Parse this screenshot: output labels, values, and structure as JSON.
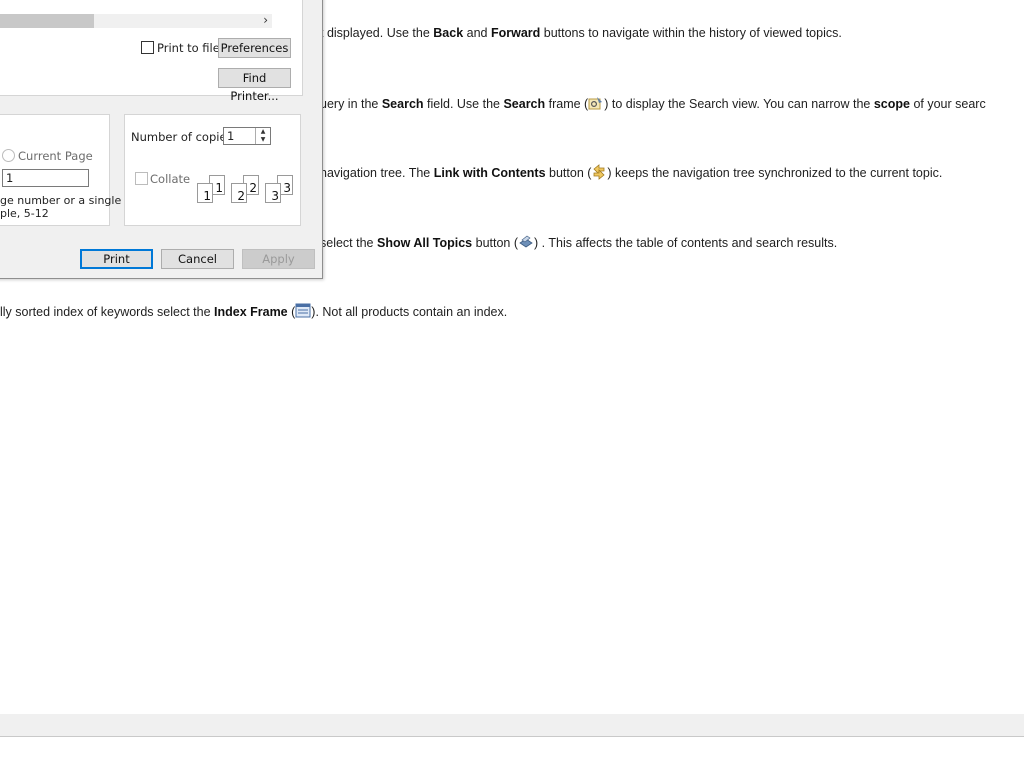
{
  "help": {
    "line1": {
      "pre": "t displayed. Use the ",
      "b1": "Back",
      "mid1": " and ",
      "b2": "Forward",
      "post": " buttons to navigate within the history of viewed topics."
    },
    "line2": {
      "pre": "uery in the ",
      "b1": "Search",
      "mid1": " field. Use the ",
      "b2": "Search",
      "mid2": " frame (",
      "icon": "search-frame-icon",
      "mid3": ") to display the Search view. You can narrow the ",
      "b3": "scope",
      "post": " of your searc"
    },
    "line3": {
      "pre": " navigation tree. The ",
      "b1": "Link with Contents",
      "mid1": " button (",
      "icon": "link-with-contents-icon",
      "post": ") keeps the navigation tree synchronized to the current topic."
    },
    "line4": {
      "pre": "select the ",
      "b1": "Show All Topics",
      "mid1": " button (",
      "icon": "show-all-topics-icon",
      "post": ") . This affects the table of contents and search results."
    },
    "line5": {
      "pre": "lly sorted index of keywords select the ",
      "b1": "Index Frame",
      "mid1": " (",
      "icon": "index-frame-icon",
      "post": "). Not all products contain an index."
    }
  },
  "dialog": {
    "printer": {
      "print_to_file_label": "Print to file",
      "preferences_label": "Preferences",
      "find_printer_label": "Find Printer..."
    },
    "page_range": {
      "current_page_label": "Current Page",
      "pages_value": "1",
      "hint_line1": "ge number or a single",
      "hint_line2": "ple, 5-12"
    },
    "copies": {
      "number_label": "Number of copies:",
      "number_value": "1",
      "collate_label": "Collate",
      "pages": [
        "1",
        "1",
        "2",
        "2",
        "3",
        "3"
      ]
    },
    "buttons": {
      "print": "Print",
      "cancel": "Cancel",
      "apply": "Apply"
    }
  },
  "colors": {
    "accent_border": "#0078d7",
    "dialog_bg": "#f0f0f0"
  }
}
